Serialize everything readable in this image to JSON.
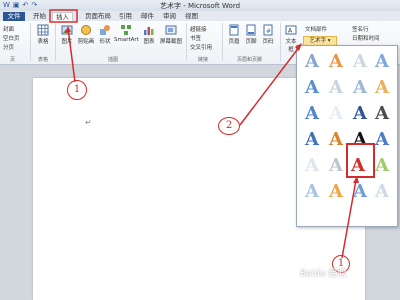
{
  "window": {
    "title": "艺术字 - Microsoft Word"
  },
  "tabs": [
    {
      "label": "文件"
    },
    {
      "label": "开始"
    },
    {
      "label": "插入"
    },
    {
      "label": "页面布局"
    },
    {
      "label": "引用"
    },
    {
      "label": "邮件"
    },
    {
      "label": "审阅"
    },
    {
      "label": "视图"
    }
  ],
  "ribbon": {
    "col1": [
      "封面",
      "空白页",
      "分页"
    ],
    "groups": {
      "pages": "页",
      "tables": "表格",
      "illustrations": "插图",
      "links": "链接",
      "header": "页眉和页脚"
    },
    "buttons": {
      "table": "表格",
      "picture": "图片",
      "clipart": "剪贴画",
      "shapes": "形状",
      "smartart": "SmartArt",
      "chart": "图表",
      "screenshot": "屏幕截图",
      "hyperlink": "超链接",
      "bookmark": "书签",
      "crossref": "交叉引用",
      "header": "页眉",
      "footer": "页脚",
      "pagenum": "页码",
      "textbox": "文本框"
    },
    "text_parts": "文档部件",
    "wordart": "艺术字",
    "signature": "签名行",
    "datetime": "日期和时间"
  },
  "annotations": {
    "n1": "1",
    "n2": "2",
    "n3": "1"
  },
  "watermark": "Baidu 经验"
}
